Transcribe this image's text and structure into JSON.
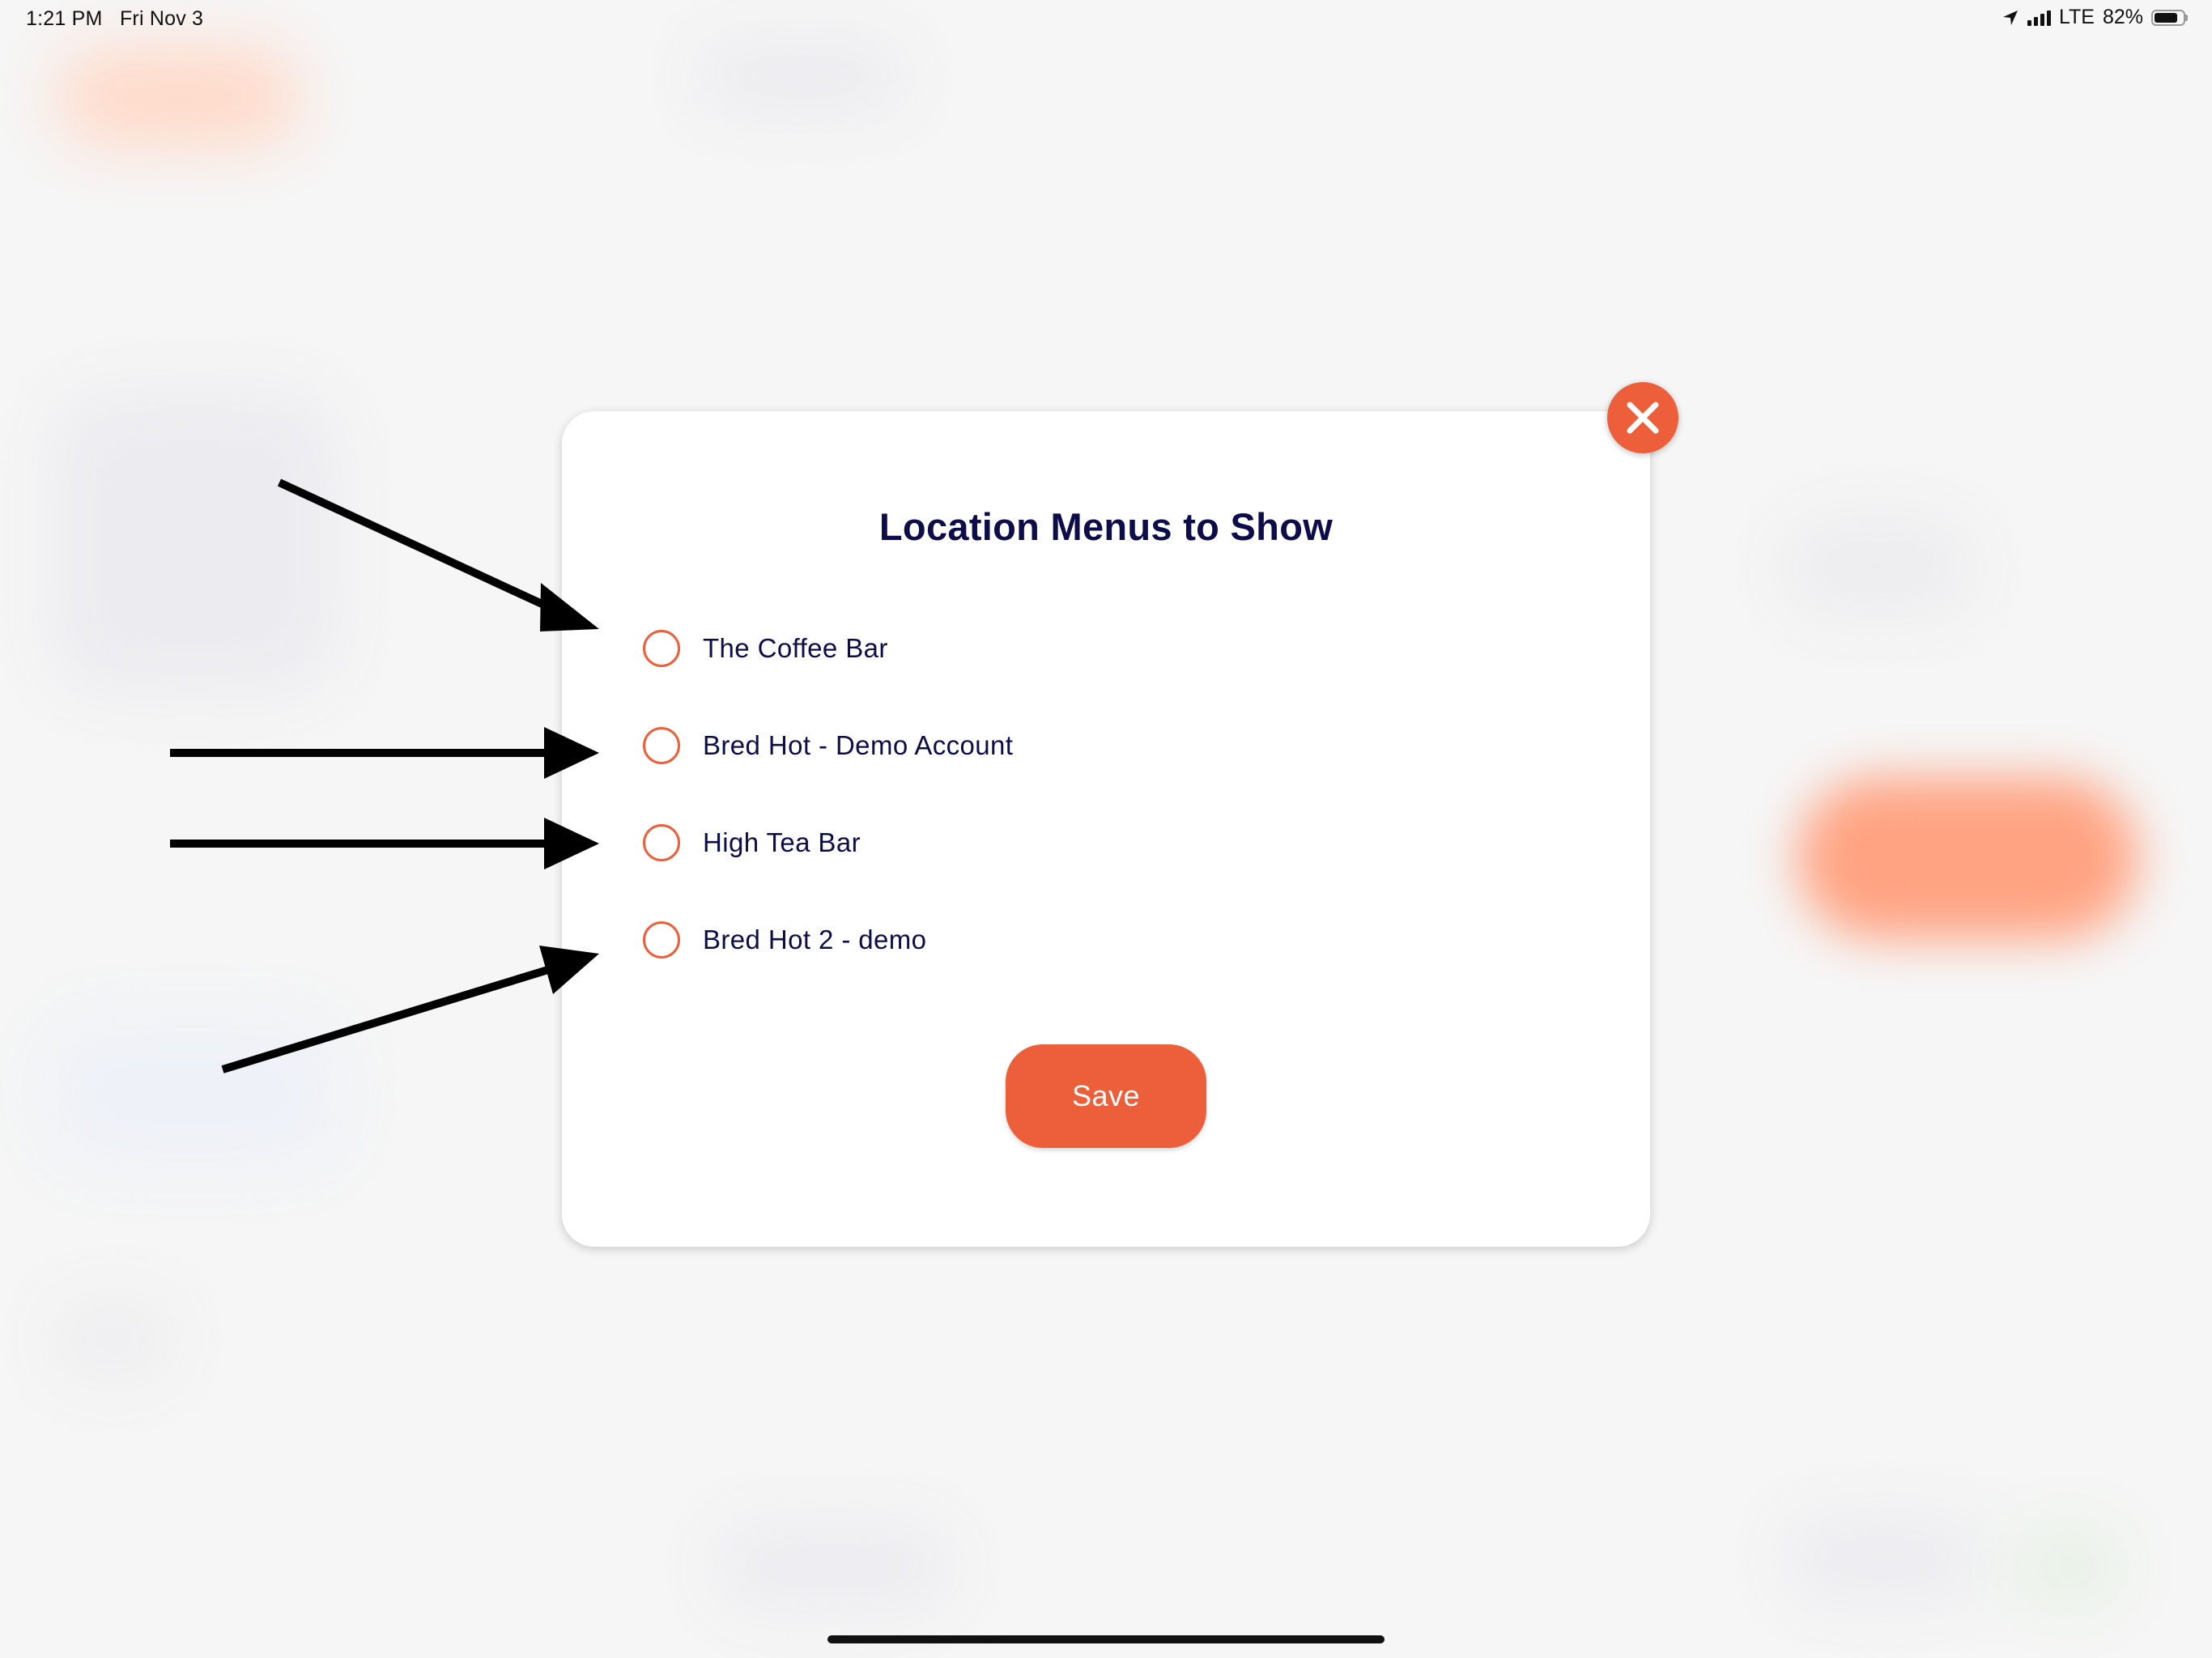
{
  "status_bar": {
    "time": "1:21 PM",
    "date": "Fri Nov 3",
    "network": "LTE",
    "battery": "82%",
    "battery_level": 0.82
  },
  "modal": {
    "title": "Location Menus to Show",
    "options": [
      {
        "label": "The Coffee Bar",
        "selected": false
      },
      {
        "label": "Bred Hot - Demo Account",
        "selected": false
      },
      {
        "label": "High Tea Bar",
        "selected": false
      },
      {
        "label": "Bred Hot 2 - demo",
        "selected": false
      }
    ],
    "save_label": "Save",
    "close_icon": "close-icon"
  },
  "colors": {
    "accent": "#ec5f3a",
    "title_text": "#0d0d4a",
    "background": "#f6f6f6",
    "annotation_arrows": "#000000"
  }
}
